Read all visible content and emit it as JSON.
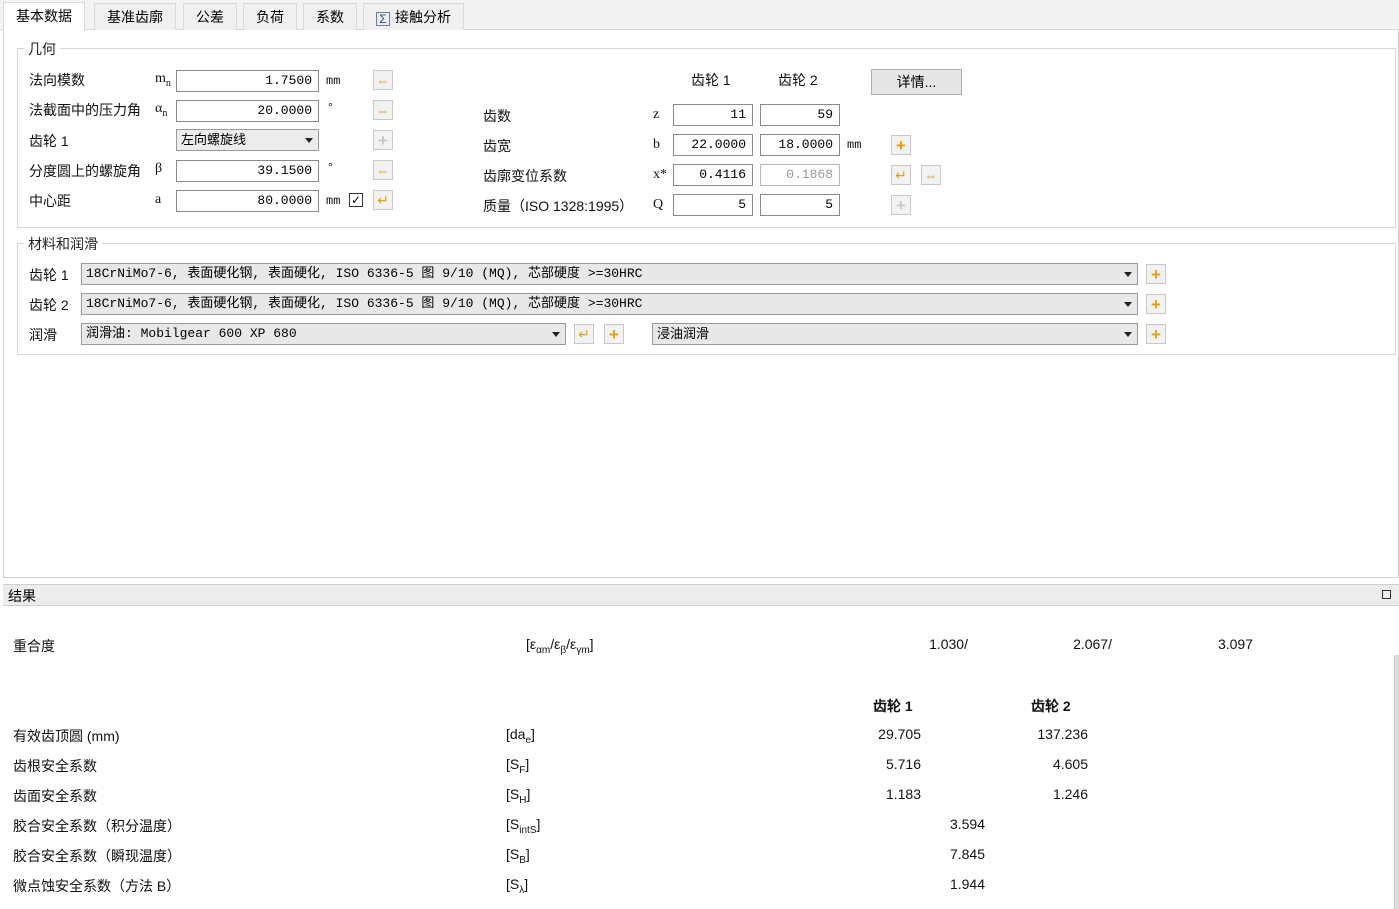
{
  "tabs": [
    "基本数据",
    "基准齿廓",
    "公差",
    "负荷",
    "系数",
    "接触分析"
  ],
  "geometry": {
    "title": "几何",
    "rows": [
      {
        "label": "法向模数",
        "symbol": "mn",
        "value": "1.7500",
        "unit": "mm"
      },
      {
        "label": "法截面中的压力角",
        "symbol": "αn",
        "value": "20.0000",
        "unit": "°"
      },
      {
        "label": "齿轮 1",
        "symbol": "",
        "value": "左向螺旋线",
        "unit": ""
      },
      {
        "label": "分度圆上的螺旋角",
        "symbol": "β",
        "value": "39.1500",
        "unit": "°"
      },
      {
        "label": "中心距",
        "symbol": "a",
        "value": "80.0000",
        "unit": "mm",
        "checked": "✓"
      }
    ],
    "gear_headers": [
      "齿轮 1",
      "齿轮 2"
    ],
    "details_button": "详情...",
    "gear_rows": [
      {
        "label": "齿数",
        "symbol": "z",
        "v1": "11",
        "v2": "59",
        "unit": ""
      },
      {
        "label": "齿宽",
        "symbol": "b",
        "v1": "22.0000",
        "v2": "18.0000",
        "unit": "mm"
      },
      {
        "label": "齿廓变位系数",
        "symbol": "x*",
        "v1": "0.4116",
        "v2": "0.1868",
        "unit": ""
      },
      {
        "label": "质量（ISO 1328:1995）",
        "symbol": "Q",
        "v1": "5",
        "v2": "5",
        "unit": ""
      }
    ]
  },
  "materials": {
    "title": "材料和润滑",
    "gear1_label": "齿轮 1",
    "gear1_value": "18CrNiMo7-6, 表面硬化钢, 表面硬化, ISO 6336-5 图 9/10 (MQ), 芯部硬度 >=30HRC",
    "gear2_label": "齿轮 2",
    "gear2_value": "18CrNiMo7-6, 表面硬化钢, 表面硬化, ISO 6336-5 图 9/10 (MQ), 芯部硬度 >=30HRC",
    "lube_label": "润滑",
    "lube_value": "润滑油: Mobilgear 600 XP 680",
    "lube_type": "浸油润滑"
  },
  "results": {
    "title": "结果",
    "overlap": {
      "label": "重合度",
      "symbol_html": "[ε<sub>αm</sub>/ε<sub>β</sub>/ε<sub>γm</sub>]",
      "v1": "1.030/",
      "v2": "2.067/",
      "v3": "3.097"
    },
    "headers": [
      "齿轮 1",
      "齿轮 2"
    ],
    "rows": [
      {
        "label": "有效齿顶圆 (mm)",
        "symbol_html": "[da<sub>e</sub>]",
        "v1": "29.705",
        "v2": "137.236"
      },
      {
        "label": "齿根安全系数",
        "symbol_html": "[S<sub>F</sub>]",
        "v1": "5.716",
        "v2": "4.605"
      },
      {
        "label": "齿面安全系数",
        "symbol_html": "[S<sub>H</sub>]",
        "v1": "1.183",
        "v2": "1.246"
      }
    ],
    "single_rows": [
      {
        "label": "胶合安全系数（积分温度）",
        "symbol_html": "[S<sub>intS</sub>]",
        "v": "3.594"
      },
      {
        "label": "胶合安全系数（瞬现温度）",
        "symbol_html": "[S<sub>B</sub>]",
        "v": "7.845"
      },
      {
        "label": "微点蚀安全系数（方法 B）",
        "symbol_html": "[S<sub>λ</sub>]",
        "v": "1.944"
      }
    ]
  },
  "accent_color": "#e8a200"
}
